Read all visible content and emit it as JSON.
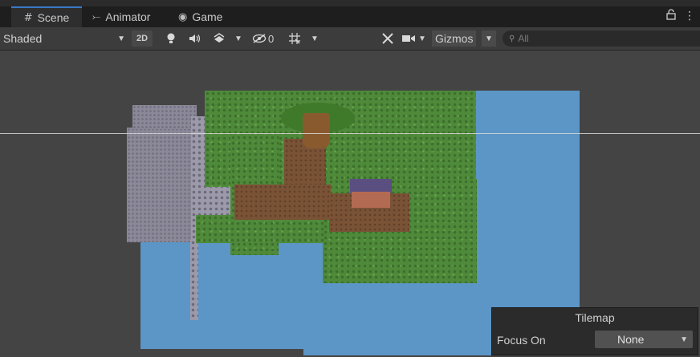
{
  "tabs": [
    {
      "label": "Scene",
      "icon": "grid-hash-icon"
    },
    {
      "label": "Animator",
      "icon": "animator-icon"
    },
    {
      "label": "Game",
      "icon": "gamepad-icon"
    }
  ],
  "tab_symbols": {
    "scene": "#",
    "animator": "⤚",
    "game": "◉",
    "lock": "🔒",
    "menu": "⋮"
  },
  "toolbar": {
    "shading_mode": "Shaded",
    "btn_2d": "2D",
    "hidden_count": "0",
    "gizmos": "Gizmos",
    "search_placeholder": "All"
  },
  "overlay": {
    "title": "Tilemap",
    "focus_label": "Focus On",
    "focus_value": "None"
  },
  "colors": {
    "accent_tab": "#3a79c7",
    "water": "#5b96c7",
    "grass": "#4f8a3a"
  }
}
